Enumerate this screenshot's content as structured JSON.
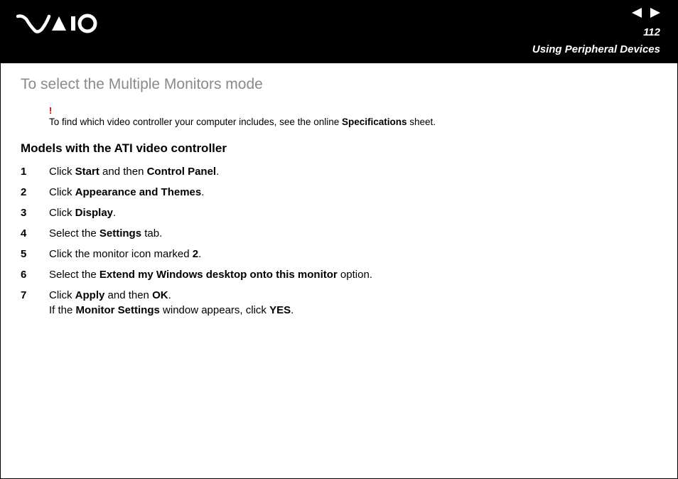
{
  "header": {
    "page_number": "112",
    "section": "Using Peripheral Devices"
  },
  "page_title": "To select the Multiple Monitors mode",
  "note": {
    "bang": "!",
    "pre": "To find which video controller your computer includes, see the online ",
    "bold": "Specifications",
    "post": " sheet."
  },
  "subsection": "Models with the ATI video controller",
  "steps": [
    {
      "num": "1",
      "parts": [
        "Click ",
        "Start",
        " and then ",
        "Control Panel",
        "."
      ]
    },
    {
      "num": "2",
      "parts": [
        "Click ",
        "Appearance and Themes",
        "."
      ]
    },
    {
      "num": "3",
      "parts": [
        "Click ",
        "Display",
        "."
      ]
    },
    {
      "num": "4",
      "parts": [
        "Select the ",
        "Settings",
        " tab."
      ]
    },
    {
      "num": "5",
      "parts": [
        "Click the monitor icon marked ",
        "2",
        "."
      ]
    },
    {
      "num": "6",
      "parts": [
        "Select the ",
        "Extend my Windows desktop onto this monitor",
        " option."
      ]
    },
    {
      "num": "7",
      "line1": [
        "Click ",
        "Apply",
        " and then ",
        "OK",
        "."
      ],
      "line2": [
        "If the ",
        "Monitor Settings",
        " window appears, click ",
        "YES",
        "."
      ]
    }
  ]
}
